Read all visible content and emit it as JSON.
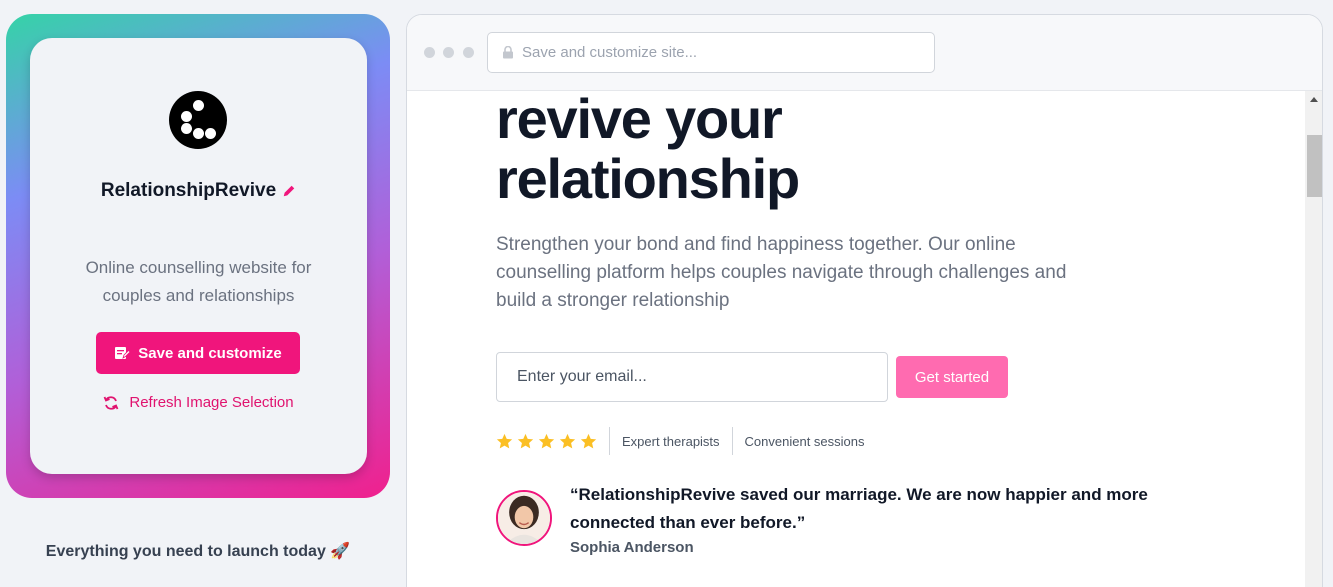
{
  "sidebar": {
    "brand_name": "RelationshipRevive",
    "description": "Online counselling website for couples and relationships",
    "save_label": "Save and customize",
    "refresh_label": "Refresh Image Selection",
    "tagline": "Everything you need to launch today 🚀"
  },
  "browser": {
    "address_placeholder": "Save and customize site..."
  },
  "hero": {
    "title_line1": "revive your",
    "title_line2": "relationship",
    "subtitle": "Strengthen your bond and find happiness together. Our online counselling platform helps couples navigate through challenges and build a stronger relationship",
    "email_placeholder": "Enter your email...",
    "cta_label": "Get started",
    "rating_stars": 5,
    "features": [
      "Expert therapists",
      "Convenient sessions"
    ]
  },
  "testimonial": {
    "quote": "“RelationshipRevive saved our marriage. We are now happier and more connected than ever before.”",
    "author": "Sophia Anderson"
  },
  "icons": {
    "logo": "dots-logo-icon",
    "edit": "pencil-icon",
    "save": "edit-note-icon",
    "refresh": "refresh-icon",
    "lock": "lock-icon",
    "star": "star-icon",
    "launch": "rocket-icon"
  },
  "colors": {
    "accent": "#f0157c",
    "cta": "#ff6bb0",
    "star": "#fbbf24",
    "heading": "#111827",
    "muted": "#6b7280"
  }
}
